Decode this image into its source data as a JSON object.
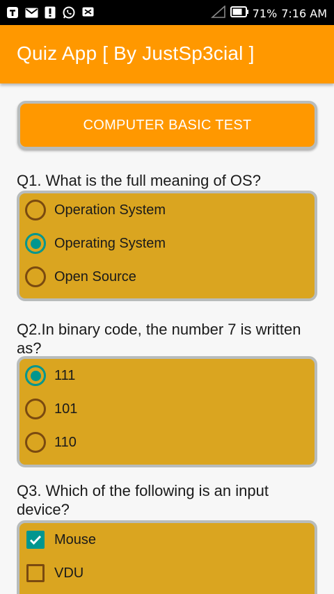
{
  "status_bar": {
    "battery": "71%",
    "time": "7:16 AM",
    "notification_icons": [
      "t-icon",
      "mail-icon",
      "alert-icon",
      "whatsapp-icon",
      "message-icon"
    ]
  },
  "app_bar": {
    "title": "Quiz App [ By JustSp3cial ]"
  },
  "test_button": {
    "label": "COMPUTER BASIC TEST"
  },
  "questions": [
    {
      "text": "Q1. What is the full meaning of OS?",
      "options": [
        "Operation System",
        "Operating System",
        "Open Source"
      ],
      "selected": 1
    },
    {
      "text": "Q2.In binary code, the number 7 is written as?",
      "options": [
        "111",
        "101",
        "110"
      ],
      "selected": 0
    },
    {
      "text": "Q3. Which of the following is an input device?",
      "options": [
        "Mouse",
        "VDU"
      ],
      "checked": [
        true,
        false
      ]
    }
  ],
  "colors": {
    "accent": "#ff9800",
    "option_bg": "#daa520",
    "checked": "#00968f"
  }
}
